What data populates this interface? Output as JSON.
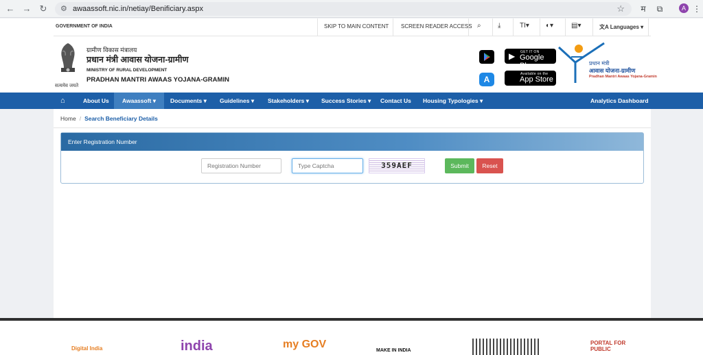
{
  "browser": {
    "url": "awaassoft.nic.in/netiay/Benificiary.aspx",
    "profile_initial": "A",
    "extension_label": "म"
  },
  "utility": {
    "government": "GOVERNMENT OF INDIA",
    "skip": "SKIP TO MAIN CONTENT",
    "screen_reader": "SCREEN READER ACCESS",
    "text_size": "T",
    "languages": "Languages"
  },
  "header": {
    "ministry_hi": "ग्रामीण विकास मंत्रालय",
    "scheme_hi": "प्रधान मंत्री आवास योजना-ग्रामीण",
    "ministry_en": "MINISTRY OF RURAL DEVELOPMENT",
    "scheme_en": "PRADHAN MANTRI AWAAS YOJANA-GRAMIN",
    "emblem_caption": "सत्यमेव जयते",
    "google_play_small": "GET IT ON",
    "google_play_big": "Google Play",
    "app_store_small": "Available on the",
    "app_store_big": "App Store",
    "pmay_logo_hi1": "प्रधान मंत्री",
    "pmay_logo_hi2": "आवास योजना-ग्रामीण",
    "pmay_logo_en": "Pradhan Mantri Awaas Yojana-Gramin"
  },
  "nav": {
    "items": [
      {
        "label": "About Us"
      },
      {
        "label": "Awaassoft ▾"
      },
      {
        "label": "Documents ▾"
      },
      {
        "label": "Guidelines ▾"
      },
      {
        "label": "Stakeholders ▾"
      },
      {
        "label": "Success Stories ▾"
      },
      {
        "label": "Contact Us"
      },
      {
        "label": "Housing Typologies ▾"
      }
    ],
    "analytics": "Analytics Dashboard"
  },
  "breadcrumb": {
    "home": "Home",
    "sep": "/",
    "current": "Search Beneficiary Details"
  },
  "form": {
    "panel_title": "Enter Registration Number",
    "registration_placeholder": "Registration Number",
    "captcha_placeholder": "Type Captcha",
    "captcha_text": "359AEF",
    "submit": "Submit",
    "reset": "Reset"
  },
  "footer": {
    "logos": [
      "Digital India",
      "india",
      "my GOV",
      "MAKE IN INDIA",
      "PORTAL FOR PUBLIC"
    ]
  },
  "colors": {
    "nav_bg": "#1d5fa8",
    "submit": "#5cb85c",
    "reset": "#d9534f"
  }
}
